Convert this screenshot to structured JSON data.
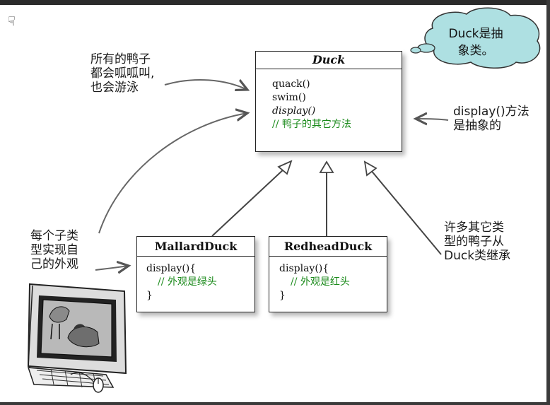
{
  "classes": {
    "duck": {
      "name": "Duck",
      "methods": [
        "quack()",
        "swim()",
        "display()"
      ],
      "comment": "// 鸭子的其它方法"
    },
    "mallard": {
      "name": "MallardDuck",
      "lines": [
        "display(){",
        "// 外观是绿头",
        "}"
      ]
    },
    "redhead": {
      "name": "RedheadDuck",
      "lines": [
        "display(){",
        "// 外观是红头",
        "}"
      ]
    }
  },
  "notes": {
    "cloud": "Duck是抽象类。",
    "all_ducks": [
      "所有的鸭子",
      "都会呱呱叫,",
      "也会游泳"
    ],
    "display_abstract": [
      "display()方法",
      "是抽象的"
    ],
    "each_subclass": [
      "每个子类",
      "型实现自",
      "己的外观"
    ],
    "many_ducks": [
      "许多其它类",
      "型的鸭子从",
      "Duck类继承"
    ]
  },
  "colors": {
    "comment": "#1a8a1a",
    "cloud_fill": "#aee0e2",
    "border": "#222222"
  }
}
